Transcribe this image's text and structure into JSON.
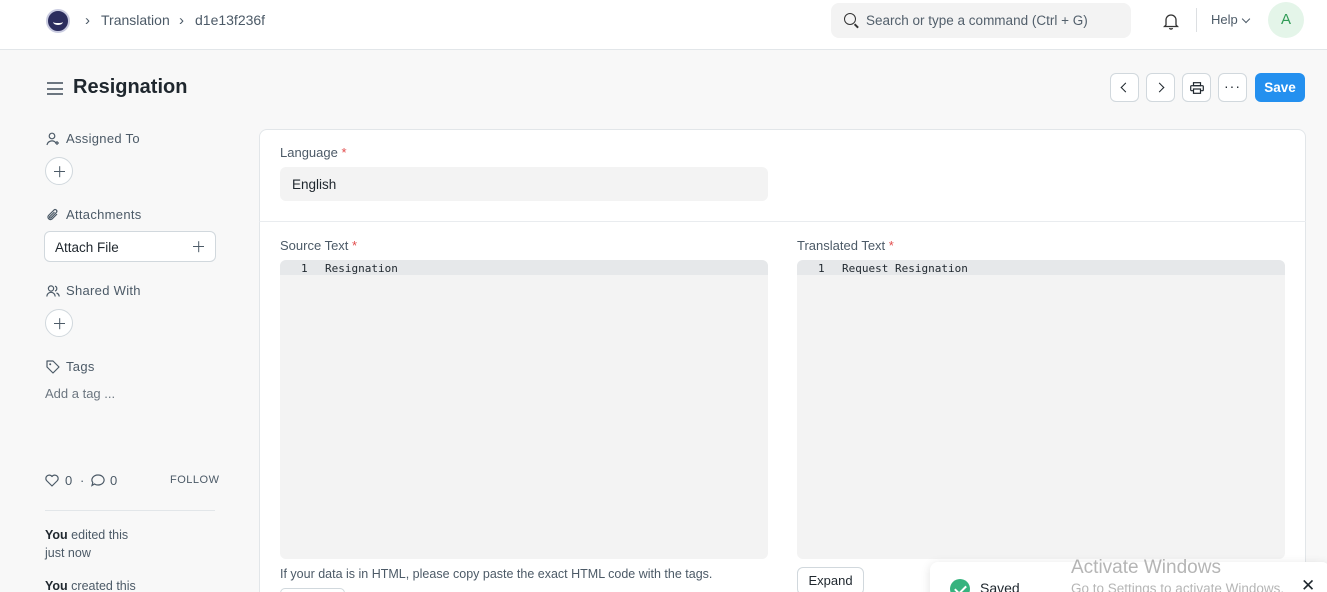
{
  "navbar": {
    "breadcrumbs": [
      "Translation",
      "d1e13f236f"
    ],
    "search_placeholder": "Search or type a command (Ctrl + G)",
    "help_label": "Help",
    "avatar_initial": "A"
  },
  "header": {
    "title": "Resignation",
    "save_label": "Save",
    "more_label": "···"
  },
  "sidebar": {
    "assigned_to_label": "Assigned To",
    "attachments_label": "Attachments",
    "attach_file_label": "Attach File",
    "shared_with_label": "Shared With",
    "tags_label": "Tags",
    "add_tag_placeholder": "Add a tag ...",
    "likes_text": "0 · ◯ 0",
    "likes_count": "0",
    "comments_count": "0",
    "follow_label": "FOLLOW",
    "activity": [
      {
        "who": "You",
        "action": "edited this",
        "when": "just now"
      },
      {
        "who": "You",
        "action": "created this",
        "when": ""
      }
    ]
  },
  "form": {
    "language_label": "Language",
    "language_value": "English",
    "source_label": "Source Text",
    "source_line_no": "1",
    "source_text": "Resignation",
    "translated_label": "Translated Text",
    "translated_line_no": "1",
    "translated_text": "Request Resignation",
    "required_mark": "*",
    "html_help": "If your data is in HTML, please copy paste the exact HTML code with the tags.",
    "expand_label": "Expand"
  },
  "toast": {
    "message": "Saved",
    "close_symbol": "✕"
  },
  "watermark": {
    "title": "Activate Windows",
    "subtitle": "Go to Settings to activate Windows."
  },
  "colors": {
    "primary": "#2490ef",
    "success": "#36b37e",
    "required": "#e24c4c",
    "avatar_bg": "#e4f5e9"
  }
}
